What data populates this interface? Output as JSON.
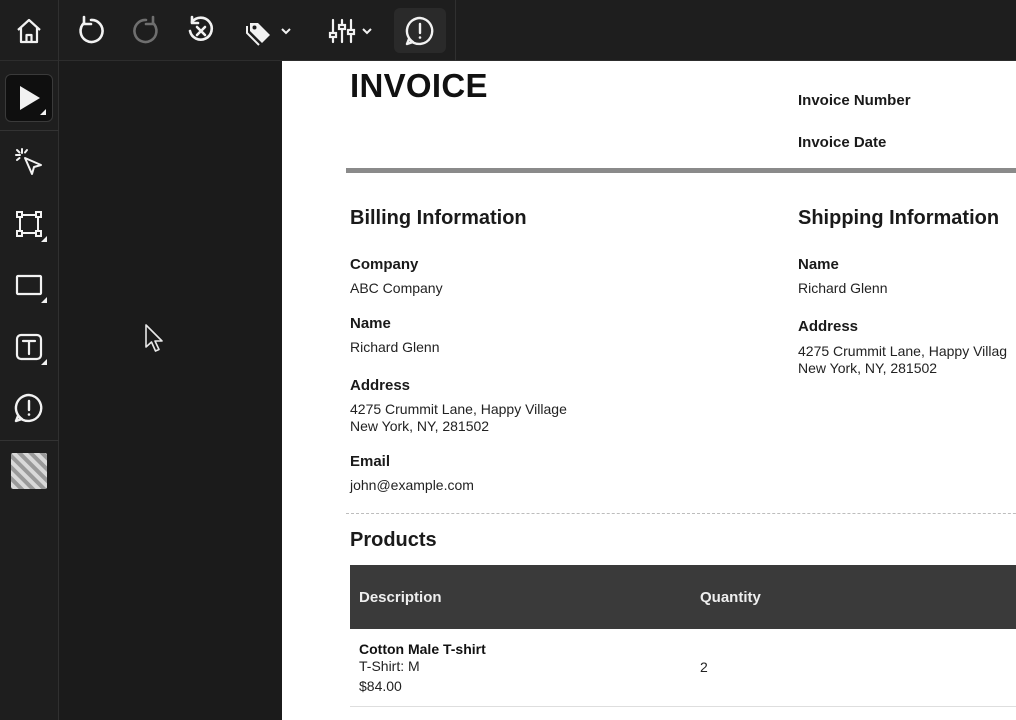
{
  "document": {
    "title": "INVOICE",
    "invoice_number_label": "Invoice Number",
    "invoice_date_label": "Invoice Date",
    "billing": {
      "heading": "Billing Information",
      "company_label": "Company",
      "company_value": "ABC Company",
      "name_label": "Name",
      "name_value": "Richard Glenn",
      "address_label": "Address",
      "address_line1": "4275 Crummit Lane, Happy Village",
      "address_line2": "New York, NY, 281502",
      "email_label": "Email",
      "email_value": "john@example.com"
    },
    "shipping": {
      "heading": "Shipping Information",
      "name_label": "Name",
      "name_value": "Richard Glenn",
      "address_label": "Address",
      "address_line1": "4275 Crummit Lane, Happy Villag",
      "address_line2": "New York, NY, 281502"
    },
    "products": {
      "heading": "Products",
      "columns": [
        "Description",
        "Quantity"
      ],
      "rows": [
        {
          "name": "Cotton Male T-shirt",
          "variant": "T-Shirt: M",
          "price": "$84.00",
          "quantity": "2"
        }
      ]
    }
  },
  "theme": {
    "chrome_bg": "#1e1e1e",
    "canvas_bg": "#1b1b1b",
    "table_header_bg": "#3a3a3a",
    "icon_color": "#f2f2f2"
  },
  "icons": {
    "toolbar": [
      "home-icon",
      "undo-icon",
      "redo-icon",
      "clear-history-icon",
      "tag-icon",
      "sliders-icon",
      "comment-alert-icon"
    ],
    "tools": [
      "pointer-icon",
      "click-select-icon",
      "crop-region-icon",
      "rectangle-icon",
      "text-tool-icon",
      "comment-alert-icon",
      "pattern-swatch-icon"
    ]
  }
}
